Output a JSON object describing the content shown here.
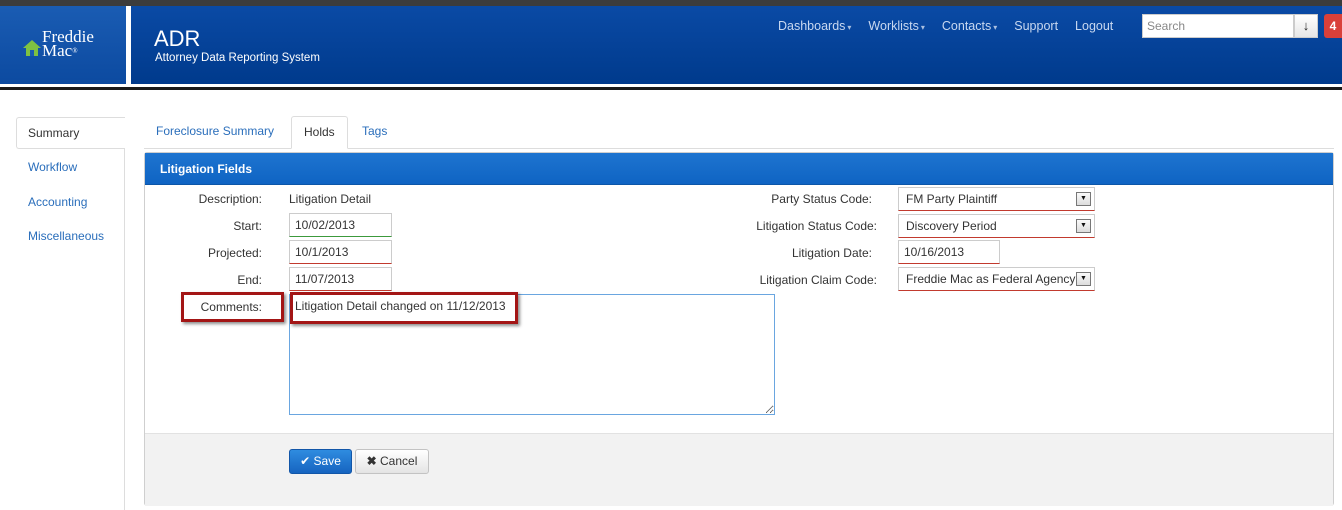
{
  "header": {
    "logo_line1": "Freddie",
    "logo_line2": "Mac",
    "logo_reg": "®",
    "app_title": "ADR",
    "app_subtitle": "Attorney Data Reporting System",
    "nav": [
      {
        "label": "Dashboards",
        "caret": "▾"
      },
      {
        "label": "Worklists",
        "caret": "▾"
      },
      {
        "label": "Contacts",
        "caret": "▾"
      },
      {
        "label": "Support",
        "caret": ""
      },
      {
        "label": "Logout",
        "caret": ""
      }
    ],
    "search_placeholder": "Search",
    "search_button_icon": "download-arrow-icon",
    "badge_count": "4"
  },
  "leftnav": {
    "items": [
      "Summary",
      "Workflow",
      "Accounting",
      "Miscellaneous"
    ],
    "active": "Summary"
  },
  "tabs": {
    "items": [
      "Foreclosure Summary",
      "Holds",
      "Tags"
    ],
    "active": "Holds"
  },
  "panel": {
    "title": "Litigation Fields",
    "left": {
      "description_label": "Description:",
      "description_value": "Litigation Detail",
      "start_label": "Start:",
      "start_value": "10/02/2013",
      "projected_label": "Projected:",
      "projected_value": "10/1/2013",
      "end_label": "End:",
      "end_value": "11/07/2013",
      "comments_label": "Comments:",
      "comments_value": "Litigation Detail changed on 11/12/2013"
    },
    "right": {
      "party_status_label": "Party Status Code:",
      "party_status_value": "FM Party Plaintiff",
      "litigation_status_label": "Litigation Status Code:",
      "litigation_status_value": "Discovery Period",
      "litigation_date_label": "Litigation Date:",
      "litigation_date_value": "10/16/2013",
      "claim_code_label": "Litigation Claim Code:",
      "claim_code_value": "Freddie Mac as Federal Agency"
    },
    "save_label": "Save",
    "cancel_label": "Cancel"
  },
  "colors": {
    "header_blue": "#003a8c",
    "panel_head_blue": "#1e74d0",
    "link_blue": "#2a6ebb",
    "highlight_red": "#a31515",
    "badge_red": "#d9403a"
  }
}
